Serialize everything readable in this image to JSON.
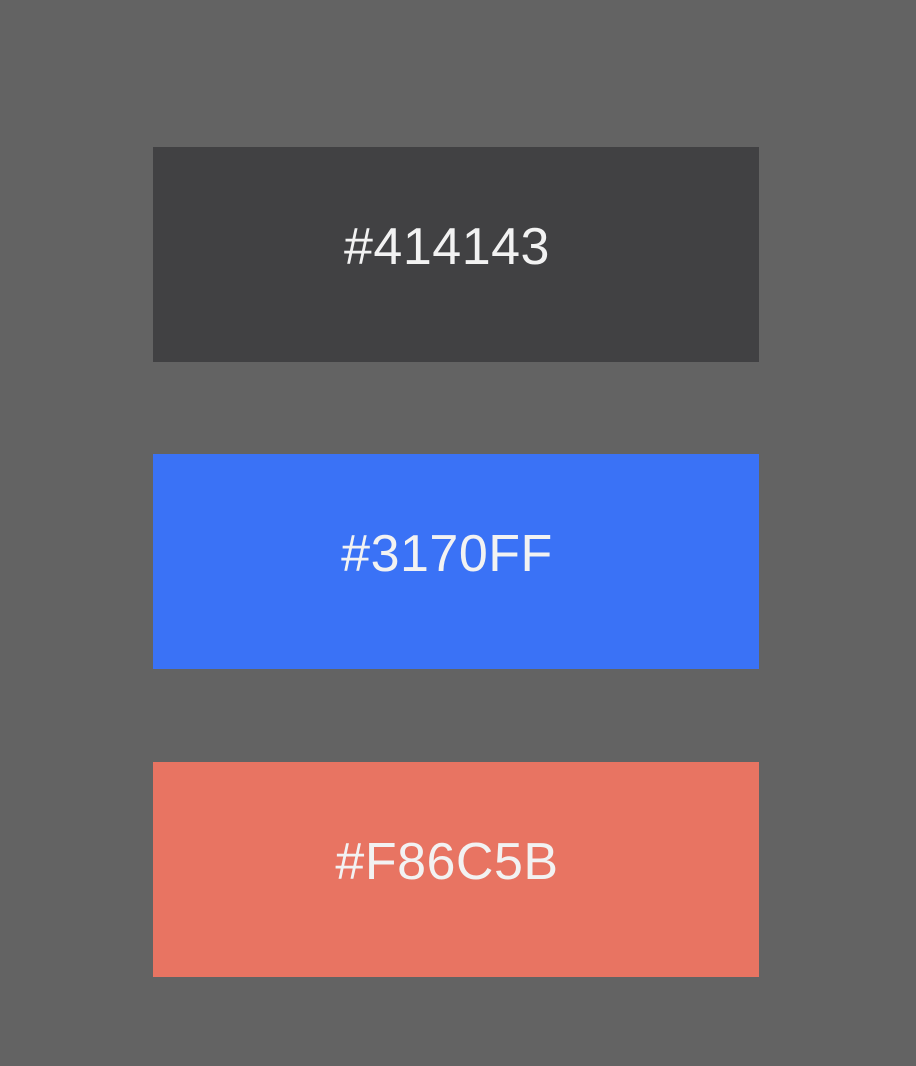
{
  "background_color": "#636363",
  "swatches": [
    {
      "label": "#414143",
      "color": "#414143"
    },
    {
      "label": "#3170FF",
      "color": "#3A72F6"
    },
    {
      "label": "#F86C5B",
      "color": "#E87462"
    }
  ]
}
